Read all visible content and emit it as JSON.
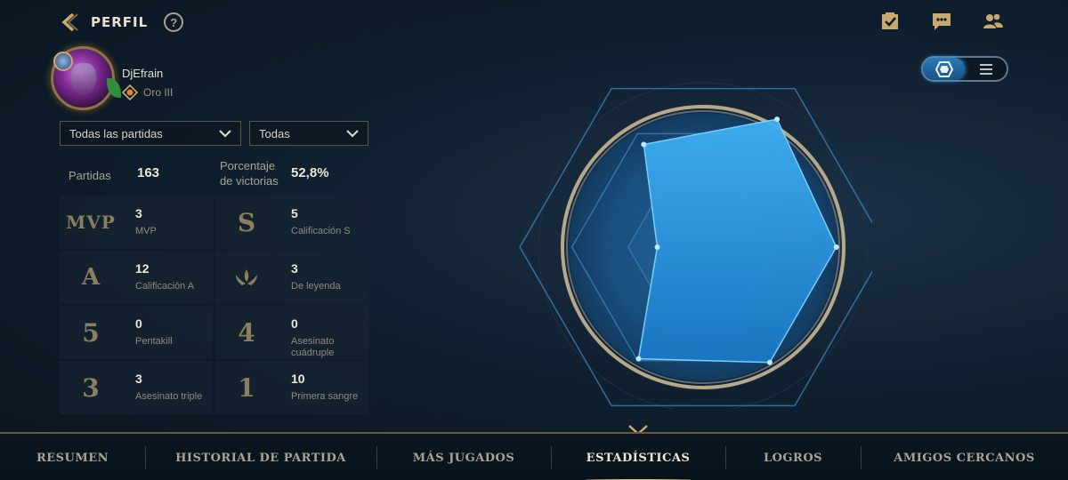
{
  "header": {
    "title": "PERFIL",
    "help": "?"
  },
  "top_icons": [
    "mission-checklist-icon",
    "chat-icon",
    "friends-icon"
  ],
  "profile": {
    "username": "DjEfrain",
    "rank": "Oro III"
  },
  "filters": {
    "mode": {
      "selected": "Todas las partidas"
    },
    "role": {
      "selected": "Todas"
    }
  },
  "summary": {
    "games_label": "Partidas",
    "games_value": "163",
    "winrate_label_1": "Porcentaje",
    "winrate_label_2": "de victorias",
    "winrate_value": "52,8%"
  },
  "stats": [
    {
      "icon_text": "MVP",
      "value": "3",
      "label": "MVP"
    },
    {
      "icon_text": "S",
      "value": "5",
      "label": "Calificación S"
    },
    {
      "icon_text": "A",
      "value": "12",
      "label": "Calificación A"
    },
    {
      "icon": "legend-crown-icon",
      "value": "3",
      "label": "De leyenda"
    },
    {
      "icon_text": "5",
      "value": "0",
      "label": "Pentakill"
    },
    {
      "icon_text": "4",
      "value": "0",
      "label": "Asesinato cuádruple"
    },
    {
      "icon_text": "3",
      "value": "3",
      "label": "Asesinato triple"
    },
    {
      "icon_text": "1",
      "value": "10",
      "label": "Primera sangre"
    }
  ],
  "radar": {
    "axes": [
      "helmet-icon",
      "horned-helmet-icon",
      "orb-icon",
      "crossed-tools-icon",
      "shield-icon",
      "chess-piece-icon"
    ],
    "values": [
      0.57,
      0.71,
      0.64,
      0.64,
      0.62,
      0.22
    ]
  },
  "tabs": [
    {
      "label": "RESUMEN",
      "active": false
    },
    {
      "label": "HISTORIAL DE PARTIDA",
      "active": false
    },
    {
      "label": "MÁS JUGADOS",
      "active": false
    },
    {
      "label": "ESTADÍSTICAS",
      "active": true
    },
    {
      "label": "LOGROS",
      "active": false
    },
    {
      "label": "AMIGOS CERCANOS",
      "active": false
    }
  ],
  "colors": {
    "gold": "#c8aa6e",
    "accent_blue": "#2a9ee8",
    "background": "#10202f"
  }
}
